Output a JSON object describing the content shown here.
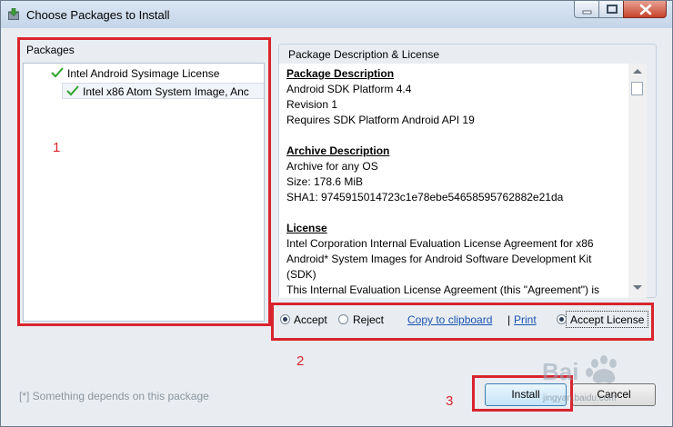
{
  "window": {
    "title": "Choose Packages to Install"
  },
  "packages": {
    "label": "Packages",
    "items": [
      {
        "label": "Intel Android Sysimage License",
        "checked": true
      },
      {
        "label": "Intel x86 Atom System Image, Anc",
        "checked": true,
        "selected": true
      }
    ]
  },
  "description": {
    "label": "Package Description & License",
    "lines": [
      {
        "text": "Package Description",
        "heading": true
      },
      {
        "text": "Android SDK Platform 4.4",
        "heading": false
      },
      {
        "text": "Revision 1",
        "heading": false
      },
      {
        "text": "Requires SDK Platform Android API 19",
        "heading": false
      },
      {
        "text": "Archive Description",
        "heading": true
      },
      {
        "text": "Archive for any OS",
        "heading": false
      },
      {
        "text": "Size: 178.6 MiB",
        "heading": false
      },
      {
        "text": "SHA1: 9745915014723c1e78ebe54658595762882e21da",
        "heading": false
      },
      {
        "text": "License",
        "heading": true
      },
      {
        "text": "Intel Corporation Internal Evaluation License Agreement for x86",
        "heading": false
      },
      {
        "text": "Android* System Images for Android Software Development Kit",
        "heading": false
      },
      {
        "text": "(SDK)",
        "heading": false
      },
      {
        "text": "This Internal Evaluation License Agreement (this \"Agreement\") is",
        "heading": false
      }
    ]
  },
  "license_options": {
    "accept": "Accept",
    "reject": "Reject",
    "copy_link": "Copy to clipboard",
    "separator": "|",
    "print_link": "Print",
    "accept_license": "Accept License"
  },
  "footer": {
    "hint": "[*] Something depends on this package",
    "install": "Install",
    "cancel": "Cancel"
  },
  "annotations": {
    "n1": "1",
    "n2": "2",
    "n3": "3"
  },
  "watermark": {
    "brand": "Bai",
    "site": "jingyan.baidu.com"
  },
  "colors": {
    "annotation_red": "#d9242e",
    "link_blue": "#1a53b0",
    "check_green": "#2ca52c"
  }
}
